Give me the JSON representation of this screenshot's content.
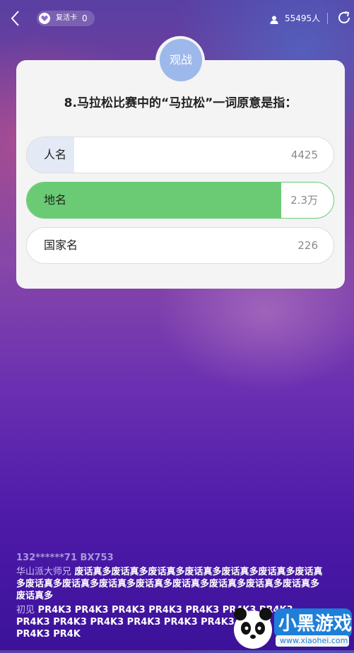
{
  "topbar": {
    "back_icon": "chevron-left-icon",
    "revive_card": {
      "label": "复活卡",
      "count": "0",
      "icon": "heart-icon"
    },
    "viewers": {
      "count": "55495人",
      "icon": "person-icon"
    },
    "share_icon": "share-icon"
  },
  "card": {
    "badge_label": "观战",
    "question": "8.马拉松比赛中的“马拉松”一词原意是指：",
    "options": [
      {
        "label": "人名",
        "count": "4425",
        "fill_fraction": 0.155,
        "fill_color": "#e3e9f5"
      },
      {
        "label": "地名",
        "count": "2.3万",
        "fill_fraction": 0.83,
        "fill_color": "#6acb74"
      },
      {
        "label": "国家名",
        "count": "226",
        "fill_fraction": 0.0,
        "fill_color": "#ffffff"
      }
    ]
  },
  "chat": {
    "line1": "132******71 BX753",
    "messages": [
      {
        "name": "华山派大师兄",
        "text": "废话真多废话真多废话真多废话真多废话真多废话真多废话真多废话真多废话真多废话真多废话真多废话真多废话真多废话真多废话真多废话真多"
      },
      {
        "name": "初见",
        "text": "PR4K3 PR4K3 PR4K3 PR4K3 PR4K3 PR4K3 PR4K3 PR4K3 PR4K3 PR4K3 PR4K3 PR4K3 PR4K3 PR4K3 PR4K3 PR4K3 PR4K"
      }
    ]
  },
  "watermark": {
    "brand": "小黑游戏",
    "url": "www.xiaohei.com"
  }
}
